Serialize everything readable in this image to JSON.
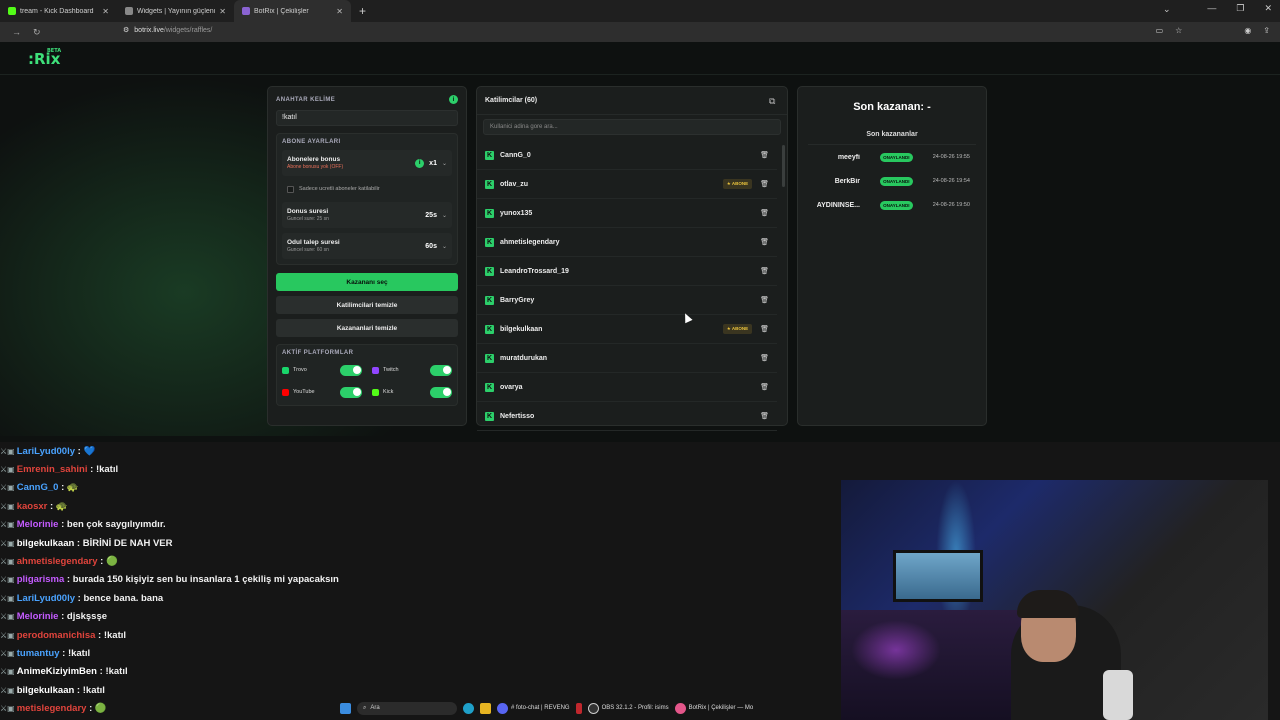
{
  "browser": {
    "tabs": [
      {
        "title": "tream - Kick Dashboard",
        "color": "#53fc18"
      },
      {
        "title": "Widgets | Yayının güçlendirme",
        "color": "#888888"
      },
      {
        "title": "BotRix | Çekilişler",
        "color": "#8a63d2",
        "active": true
      }
    ],
    "url_host": "botrix.live",
    "url_path": "/widgets/raffles/"
  },
  "logo": {
    "text": ":Rix",
    "beta": "BETA"
  },
  "settings": {
    "keyword_label": "ANAHTAR KELİME",
    "keyword_value": "!katıl",
    "subscriber_section": "ABONE AYARLARI",
    "sub_bonus_title": "Abonelere bonus",
    "sub_bonus_sub": "Abone bonusu yok (OFF)",
    "sub_bonus_value": "x1",
    "paid_only": "Sadece ucretli aboneler katilabilir",
    "bonus_time_title": "Donus suresi",
    "bonus_time_sub": "Guncel sure: 25 sn",
    "bonus_time_value": "25s",
    "claim_time_title": "Odul talep suresi",
    "claim_time_sub": "Guncel sure: 60 sn",
    "claim_time_value": "60s",
    "pick_winner": "Kazananı seç",
    "clear_participants": "Katilimcilari temizle",
    "clear_winners": "Kazananlari temizle",
    "platforms_label": "AKTİF PLATFORMLAR",
    "platforms": [
      {
        "name": "Trovo",
        "on": true,
        "color": "#19d66b"
      },
      {
        "name": "Twitch",
        "on": true,
        "color": "#9146ff"
      },
      {
        "name": "YouTube",
        "on": true,
        "color": "#ff0000"
      },
      {
        "name": "Kick",
        "on": true,
        "color": "#53fc18"
      }
    ]
  },
  "participants": {
    "title": "Katilimcilar (60)",
    "search_placeholder": "Kullanici adina gore ara...",
    "sub_badge": "★ ABONE",
    "list": [
      {
        "name": "CannG_0",
        "sub": false
      },
      {
        "name": "otlav_zu",
        "sub": true
      },
      {
        "name": "yunox135",
        "sub": false
      },
      {
        "name": "ahmetislegendary",
        "sub": false
      },
      {
        "name": "LeandroTrossard_19",
        "sub": false
      },
      {
        "name": "BarryGrey",
        "sub": false
      },
      {
        "name": "bilgekulkaan",
        "sub": true
      },
      {
        "name": "muratdurukan",
        "sub": false
      },
      {
        "name": "ovarya",
        "sub": false
      },
      {
        "name": "Nefertisso",
        "sub": false
      }
    ]
  },
  "winners": {
    "last_winner_label": "Son kazanan: -",
    "list_title": "Son kazananlar",
    "badge": "ONAYLANDI",
    "list": [
      {
        "name": "meeyfi",
        "date": "24-08-26 19:55"
      },
      {
        "name": "BerkBir",
        "date": "24-08-26 19:54"
      },
      {
        "name": "AYDININSE...",
        "date": "24-08-26 19:50"
      }
    ]
  },
  "chat": [
    {
      "user": "LariLyud00ly",
      "color": "#4aa3ff",
      "msg": "💙"
    },
    {
      "user": "Emrenin_sahini",
      "color": "#e0443c",
      "msg": "!katıl"
    },
    {
      "user": "CannG_0",
      "color": "#4aa3ff",
      "msg": "🐢"
    },
    {
      "user": "kaosxr",
      "color": "#e0443c",
      "msg": "🐢"
    },
    {
      "user": "Melorinie",
      "color": "#c45bff",
      "msg": "ben çok saygılıyımdır."
    },
    {
      "user": "bilgekulkaan",
      "color": "#ffffff",
      "msg": "BİRİNİ DE NAH VER"
    },
    {
      "user": "ahmetislegendary",
      "color": "#e0443c",
      "msg": "🟢"
    },
    {
      "user": "pligarisma",
      "color": "#c45bff",
      "msg": "burada 150 kişiyiz sen bu insanlara 1 çekiliş mi yapacaksın"
    },
    {
      "user": "LariLyud00ly",
      "color": "#4aa3ff",
      "msg": "bence bana. bana"
    },
    {
      "user": "Melorinie",
      "color": "#c45bff",
      "msg": "djskşsşe"
    },
    {
      "user": "perodomanichisa",
      "color": "#e0443c",
      "msg": "!katıl"
    },
    {
      "user": "tumantuy",
      "color": "#4aa3ff",
      "msg": "!katıl"
    },
    {
      "user": "AnimeKiziyimBen",
      "color": "#ffffff",
      "msg": "!katıl"
    },
    {
      "user": "bilgekulkaan",
      "color": "#ffffff",
      "msg": "!katıl"
    },
    {
      "user": "metislegendary",
      "color": "#e0443c",
      "msg": "🟢"
    }
  ],
  "taskbar": {
    "search_label": "Ara",
    "items": [
      "# foto-chat | REVENG",
      "OBS 32.1.2 - Profil: isims",
      "BotRix | Çekilişler — Mo"
    ]
  }
}
